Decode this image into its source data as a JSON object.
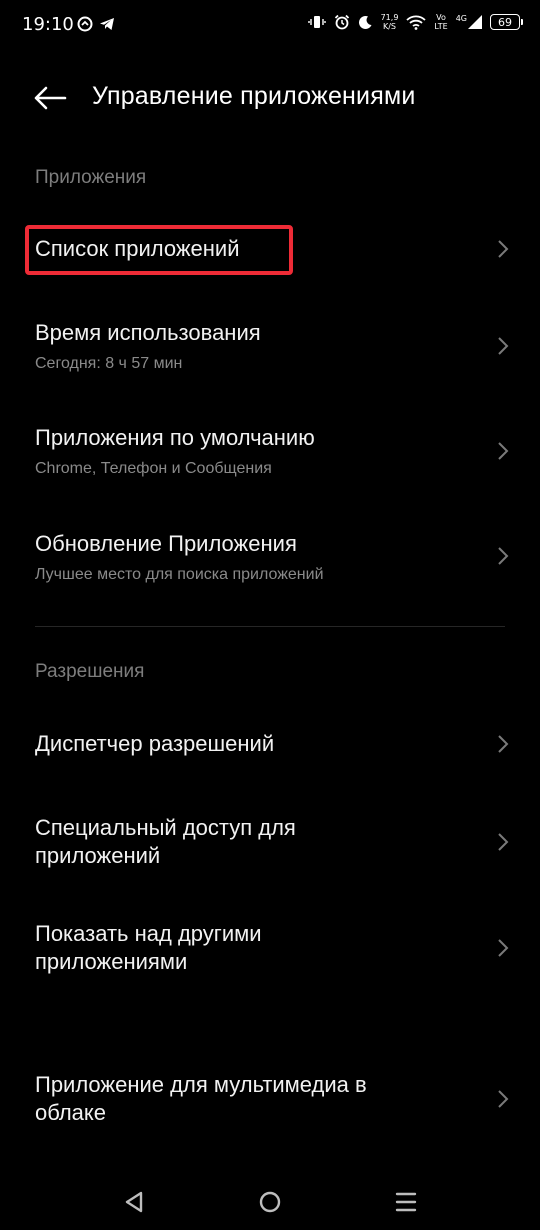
{
  "status_bar": {
    "time": "19:10",
    "net_speed_value": "71,9",
    "net_speed_unit": "K/S",
    "volte_top": "Vo",
    "volte_bottom": "LTE",
    "signal_label": "4G",
    "battery": "69"
  },
  "header": {
    "title": "Управление приложениями"
  },
  "sections": {
    "apps_label": "Приложения",
    "permissions_label": "Разрешения"
  },
  "items": [
    {
      "title": "Список приложений",
      "subtitle": ""
    },
    {
      "title": "Время использования",
      "subtitle": "Сегодня: 8 ч 57 мин"
    },
    {
      "title": "Приложения по умолчанию",
      "subtitle": "Chrome, Телефон и Сообщения"
    },
    {
      "title": "Обновление Приложения",
      "subtitle": "Лучшее место для поиска приложений"
    },
    {
      "title": "Диспетчер разрешений",
      "subtitle": ""
    },
    {
      "title_line1": "Специальный доступ для",
      "title_line2": "приложений"
    },
    {
      "title_line1": "Показать над другими",
      "title_line2": "приложениями"
    },
    {
      "title_line1": "Приложение для мультимедиа в",
      "title_line2": "облаке"
    }
  ],
  "colors": {
    "background": "#000000",
    "highlight": "#ee2b36",
    "secondary_text": "#8a8a8a"
  }
}
